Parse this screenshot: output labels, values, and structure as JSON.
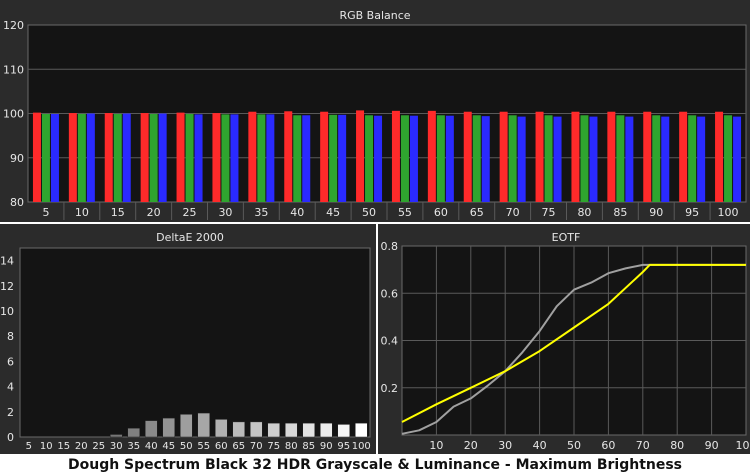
{
  "caption": "Dough Spectrum Black 32 HDR Grayscale & Luminance - Maximum Brightness",
  "colors": {
    "panel_bg": "#2b2b2b",
    "plot_bg": "#141414",
    "grid": "#5a5a5a",
    "text": "#e6e6e6",
    "red": "#ff2a2a",
    "green": "#2fa52f",
    "blue": "#2a2aff",
    "target": "#ffff00",
    "measured": "#a0a0a0"
  },
  "chart_data": [
    {
      "type": "bar",
      "title": "RGB Balance",
      "categories": [
        "5",
        "10",
        "15",
        "20",
        "25",
        "30",
        "35",
        "40",
        "45",
        "50",
        "55",
        "60",
        "65",
        "70",
        "75",
        "80",
        "85",
        "90",
        "95",
        "100"
      ],
      "ylim": [
        80,
        120
      ],
      "yticks": [
        80,
        90,
        100,
        110,
        120
      ],
      "grid": true,
      "series": [
        {
          "color": "red",
          "values": [
            100.2,
            100.1,
            100.1,
            100.1,
            100.2,
            100.1,
            100.4,
            100.5,
            100.4,
            100.7,
            100.6,
            100.6,
            100.4,
            100.4,
            100.4,
            100.4,
            100.4,
            100.4,
            100.4,
            100.4
          ]
        },
        {
          "color": "green",
          "values": [
            99.9,
            99.9,
            99.9,
            99.9,
            99.9,
            99.8,
            99.8,
            99.6,
            99.7,
            99.6,
            99.6,
            99.6,
            99.6,
            99.6,
            99.6,
            99.6,
            99.6,
            99.6,
            99.6,
            99.6
          ]
        },
        {
          "color": "blue",
          "values": [
            99.9,
            100.0,
            100.0,
            100.0,
            99.8,
            99.8,
            99.8,
            99.6,
            99.7,
            99.5,
            99.5,
            99.5,
            99.4,
            99.3,
            99.3,
            99.3,
            99.3,
            99.3,
            99.3,
            99.3
          ]
        }
      ]
    },
    {
      "type": "bar",
      "title": "DeltaE 2000",
      "categories": [
        "5",
        "10",
        "15",
        "20",
        "25",
        "30",
        "35",
        "40",
        "45",
        "50",
        "55",
        "60",
        "65",
        "70",
        "75",
        "80",
        "85",
        "90",
        "95",
        "100"
      ],
      "values": [
        0,
        0,
        0,
        0,
        0,
        0.2,
        0.7,
        1.3,
        1.5,
        1.8,
        1.9,
        1.4,
        1.2,
        1.2,
        1.1,
        1.1,
        1.1,
        1.1,
        1.0,
        1.1
      ],
      "ylim": [
        0,
        15
      ],
      "yticks": [
        0,
        2,
        4,
        6,
        8,
        10,
        12,
        14
      ],
      "grid": false
    },
    {
      "type": "line",
      "title": "EOTF",
      "xlim": [
        0,
        100
      ],
      "ylim": [
        0,
        0.8
      ],
      "xticks": [
        10,
        20,
        30,
        40,
        50,
        60,
        70,
        80,
        90,
        100
      ],
      "yticks": [
        0.2,
        0.4,
        0.6,
        0.8
      ],
      "grid": true,
      "series": [
        {
          "color": "target",
          "x": [
            0,
            10,
            20,
            30,
            40,
            50,
            60,
            70,
            72,
            80,
            90,
            100
          ],
          "y": [
            0.055,
            0.13,
            0.2,
            0.27,
            0.355,
            0.455,
            0.555,
            0.69,
            0.72,
            0.72,
            0.72,
            0.72
          ]
        },
        {
          "color": "measured",
          "x": [
            0,
            5,
            10,
            15,
            20,
            25,
            30,
            35,
            40,
            45,
            50,
            55,
            60,
            65,
            70,
            72,
            75,
            80,
            90,
            100
          ],
          "y": [
            0.005,
            0.02,
            0.055,
            0.12,
            0.155,
            0.21,
            0.27,
            0.35,
            0.44,
            0.545,
            0.615,
            0.645,
            0.685,
            0.705,
            0.72,
            0.72,
            0.72,
            0.72,
            0.72,
            0.72
          ]
        }
      ]
    }
  ]
}
